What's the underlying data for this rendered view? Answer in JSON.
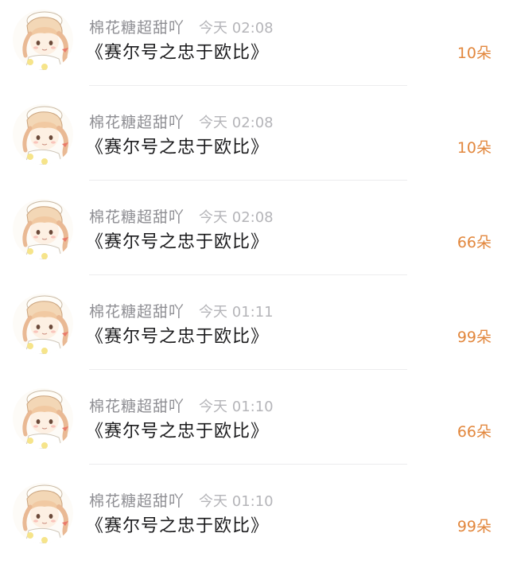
{
  "gifts": [
    {
      "user": "棉花糖超甜吖",
      "time": "今天 02:08",
      "title": "《赛尔号之忠于欧比》",
      "count": "10朵"
    },
    {
      "user": "棉花糖超甜吖",
      "time": "今天 02:08",
      "title": "《赛尔号之忠于欧比》",
      "count": "10朵"
    },
    {
      "user": "棉花糖超甜吖",
      "time": "今天 02:08",
      "title": "《赛尔号之忠于欧比》",
      "count": "66朵"
    },
    {
      "user": "棉花糖超甜吖",
      "time": "今天 01:11",
      "title": "《赛尔号之忠于欧比》",
      "count": "99朵"
    },
    {
      "user": "棉花糖超甜吖",
      "time": "今天 01:10",
      "title": "《赛尔号之忠于欧比》",
      "count": "66朵"
    },
    {
      "user": "棉花糖超甜吖",
      "time": "今天 01:10",
      "title": "《赛尔号之忠于欧比》",
      "count": "99朵"
    }
  ],
  "colors": {
    "accent": "#e2873d",
    "username": "#8e8e93",
    "timestamp": "#b5b5b9",
    "title": "#1c1c1e",
    "divider": "#ececee"
  },
  "icons": {
    "avatar": "user-avatar-anime-girl"
  }
}
